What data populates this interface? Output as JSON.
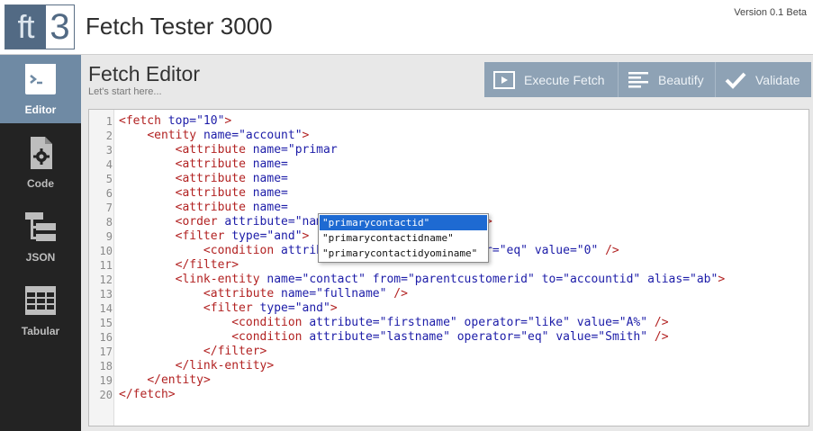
{
  "header": {
    "logo_ft": "ft",
    "logo_num": "3",
    "title": "Fetch Tester 3000",
    "version": "Version 0.1 Beta"
  },
  "sidebar": {
    "items": [
      {
        "label": "Editor",
        "icon": "terminal-icon",
        "active": true
      },
      {
        "label": "Code",
        "icon": "code-file-icon",
        "active": false
      },
      {
        "label": "JSON",
        "icon": "json-tree-icon",
        "active": false
      },
      {
        "label": "Tabular",
        "icon": "table-grid-icon",
        "active": false
      }
    ]
  },
  "main": {
    "title": "Fetch Editor",
    "subtitle": "Let's start here...",
    "toolbar": {
      "execute_label": "Execute Fetch",
      "beautify_label": "Beautify",
      "validate_label": "Validate"
    }
  },
  "editor": {
    "line_numbers": [
      "1",
      "2",
      "3",
      "4",
      "5",
      "6",
      "7",
      "8",
      "9",
      "10",
      "11",
      "12",
      "13",
      "14",
      "15",
      "16",
      "17",
      "18",
      "19",
      "20"
    ],
    "lines": [
      "<fetch top=\"10\">",
      "    <entity name=\"account\">",
      "        <attribute name=\"primar",
      "        <attribute name=",
      "        <attribute name=",
      "        <attribute name=",
      "        <attribute name=",
      "        <order attribute=\"name\" descending=\"false\" />",
      "        <filter type=\"and\">",
      "            <condition attribute=\"statecode\" operator=\"eq\" value=\"0\" />",
      "        </filter>",
      "        <link-entity name=\"contact\" from=\"parentcustomerid\" to=\"accountid\" alias=\"ab\">",
      "            <attribute name=\"fullname\" />",
      "            <filter type=\"and\">",
      "                <condition attribute=\"firstname\" operator=\"like\" value=\"A%\" />",
      "                <condition attribute=\"lastname\" operator=\"eq\" value=\"Smith\" />",
      "            </filter>",
      "        </link-entity>",
      "    </entity>",
      "</fetch>"
    ]
  },
  "autocomplete": {
    "items": [
      "\"primarycontactid\"",
      "\"primarycontactidname\"",
      "\"primarycontactidyominame\""
    ],
    "selected_index": 0
  },
  "colors": {
    "sidebar_bg": "#232323",
    "sidebar_active": "#6f8aa4",
    "toolbar_bg": "#8ea2b5",
    "tag": "#b22222",
    "attribute": "#1c1ca8",
    "selection": "#1e6ad2"
  }
}
